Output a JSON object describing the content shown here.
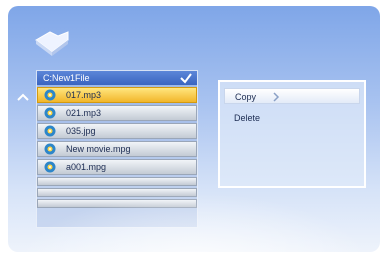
{
  "path": {
    "label": "C:New1File"
  },
  "files": [
    {
      "name": "017.mp3",
      "selected": true
    },
    {
      "name": "021.mp3",
      "selected": false
    },
    {
      "name": "035.jpg",
      "selected": false
    },
    {
      "name": "New movie.mpg",
      "selected": false
    },
    {
      "name": "a001.mpg",
      "selected": false
    }
  ],
  "menu": {
    "items": [
      {
        "label": "Copy"
      },
      {
        "label": "Delete"
      }
    ]
  },
  "icons": {
    "folder": "folder-icon",
    "check": "check-icon",
    "up": "up-arrow-icon",
    "disc": "disc-icon",
    "selection": "selection-arrow-icon"
  },
  "colors": {
    "selected_row": "#f2b62a",
    "path_bar": "#3a64c0",
    "background": "#a9c3f0"
  }
}
